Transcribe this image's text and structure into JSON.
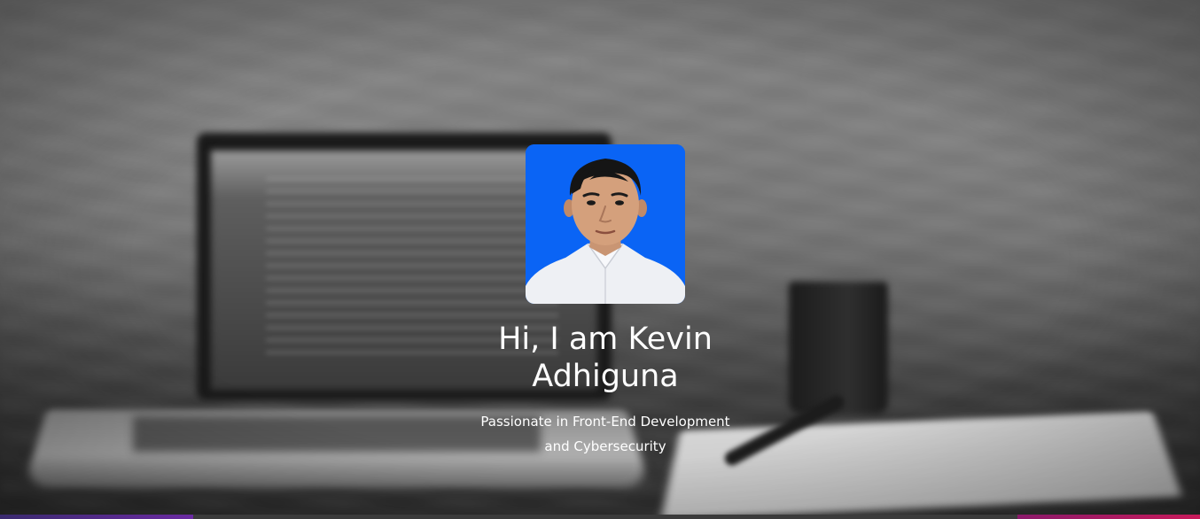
{
  "hero": {
    "background_icon": "blurred-workspace-background",
    "avatar_icon": "profile-photo",
    "avatar_bg_color": "#0a64f5",
    "title_line1": "Hi, I am Kevin",
    "title_line2": "Adhiguna",
    "subtitle_line1": "Passionate in Front-End Development",
    "subtitle_line2": "and Cybersecurity"
  },
  "colors": {
    "text": "#ffffff",
    "accent_left": "#6a2aa0",
    "accent_right": "#c81a5a"
  }
}
